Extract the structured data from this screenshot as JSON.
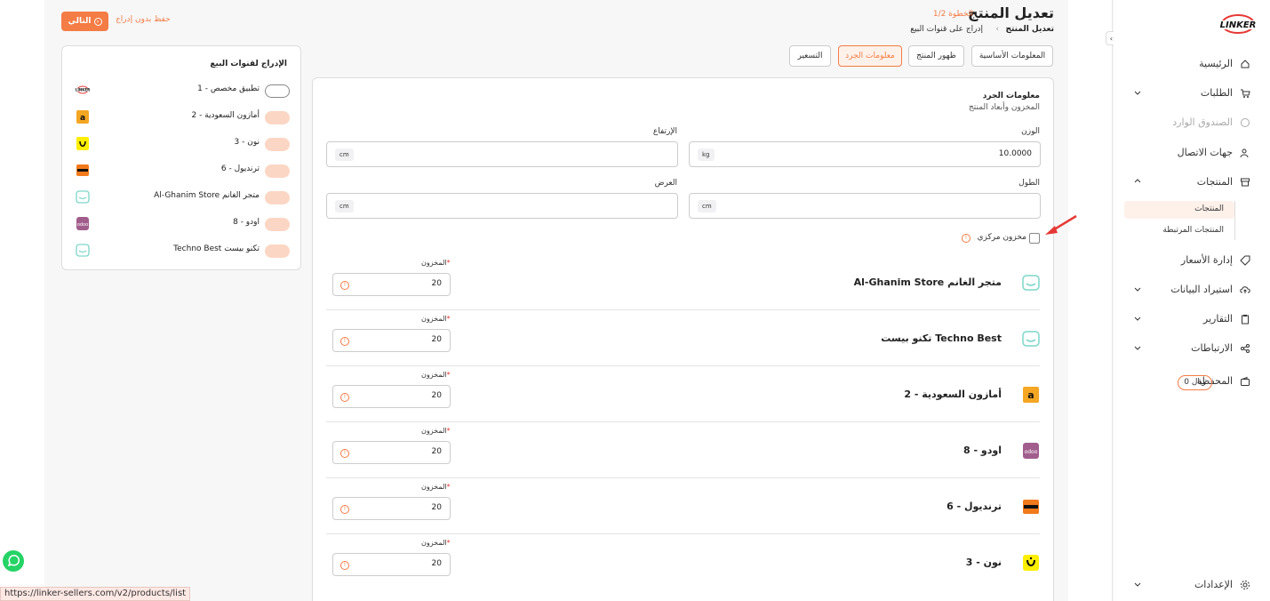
{
  "page": {
    "title": "تعديل المنتج",
    "step": "الخطوة 1/2",
    "breadcrumb": [
      "تعديل المنتج",
      "إدراج على قنوات البيع"
    ],
    "next_button": "التالي",
    "save_without_listing": "حفظ بدون إدراج"
  },
  "tabs": [
    {
      "label": "المعلومات الأساسية",
      "active": false
    },
    {
      "label": "ظهور المنتج",
      "active": false
    },
    {
      "label": "معلومات الجرد",
      "active": true
    },
    {
      "label": "التسعير",
      "active": false
    }
  ],
  "inventory": {
    "section_title": "معلومات الجرد",
    "section_subtitle": "المخزون وأبعاد المنتج",
    "weight": {
      "label": "الوزن",
      "value": "10.0000",
      "unit": "kg"
    },
    "height": {
      "label": "الإرتفاع",
      "value": "",
      "unit": "cm"
    },
    "length": {
      "label": "الطول",
      "value": "",
      "unit": "cm"
    },
    "width": {
      "label": "العرض",
      "value": "",
      "unit": "cm"
    },
    "central_stock_label": "مخزون مركزي",
    "central_stock_checked": false
  },
  "stock_label": "المخزون",
  "stock_rows": [
    {
      "name": "Al-Ghanim Store متجر الغانم",
      "logo": "store-icon",
      "stock": "20"
    },
    {
      "name": "تكنو بيست Techno Best",
      "logo": "store-icon",
      "stock": "20"
    },
    {
      "name": "أمازون السعودية - 2",
      "logo": "amazon-logo",
      "stock": "20"
    },
    {
      "name": "اودو - 8",
      "logo": "odoo-logo",
      "stock": "20"
    },
    {
      "name": "ترنديول - 6",
      "logo": "trendyol-logo",
      "stock": "20"
    },
    {
      "name": "نون - 3",
      "logo": "noon-logo",
      "stock": "20"
    }
  ],
  "channels": {
    "title": "الإدراج لقنوات البيع",
    "items": [
      {
        "name": "تطبيق مخصص - 1",
        "logo": "linker-logo",
        "enabled": false
      },
      {
        "name": "أمازون السعودية - 2",
        "logo": "amazon-logo",
        "enabled": true
      },
      {
        "name": "نون - 3",
        "logo": "noon-logo",
        "enabled": true
      },
      {
        "name": "ترنديول - 6",
        "logo": "trendyol-logo",
        "enabled": true
      },
      {
        "name": "Al-Ghanim Store متجر الغانم",
        "logo": "store-icon",
        "enabled": true
      },
      {
        "name": "اودو - 8",
        "logo": "odoo-logo",
        "enabled": true
      },
      {
        "name": "Techno Best تكنو بيست",
        "logo": "store-icon",
        "enabled": true
      }
    ]
  },
  "sidebar": {
    "logo_text": "LINKER",
    "items": [
      {
        "label": "الرئيسية",
        "icon": "home-icon"
      },
      {
        "label": "الطلبات",
        "icon": "cart-icon"
      },
      {
        "label": "الصندوق الوارد",
        "icon": "chat-icon"
      },
      {
        "label": "جهات الاتصال",
        "icon": "users-icon"
      },
      {
        "label": "المنتجات",
        "icon": "box-icon"
      },
      {
        "label": "إدارة الأسعار",
        "icon": "tag-icon"
      },
      {
        "label": "استيراد البيانات",
        "icon": "cloud-upload-icon"
      },
      {
        "label": "التقارير",
        "icon": "clipboard-icon"
      },
      {
        "label": "الارتباطات",
        "icon": "share-icon"
      },
      {
        "label": "المحفظة",
        "icon": "wallet-icon"
      },
      {
        "label": "الإعدادات",
        "icon": "gear-icon"
      }
    ],
    "product_subitems": [
      "المنتجات",
      "المنتجات المرتبطة"
    ],
    "wallet_balance": "0 ريال"
  },
  "status_bar_url": "https://linker-sellers.com/v2/products/list",
  "colors": {
    "accent": "#f47c45",
    "accent_light": "#fdf1ea"
  }
}
